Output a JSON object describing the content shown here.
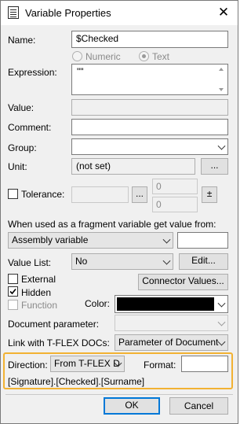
{
  "window": {
    "title": "Variable Properties",
    "close_glyph": "✕"
  },
  "name": {
    "label": "Name:",
    "value": "$Checked"
  },
  "type_radios": {
    "numeric": "Numeric",
    "text": "Text",
    "selected": "Text"
  },
  "expression": {
    "label": "Expression:",
    "value": "\"\""
  },
  "value": {
    "label": "Value:",
    "value": ""
  },
  "comment": {
    "label": "Comment:",
    "value": ""
  },
  "group": {
    "label": "Group:",
    "value": ""
  },
  "unit": {
    "label": "Unit:",
    "value": "(not set)",
    "button": "..."
  },
  "tolerance": {
    "label": "Tolerance:",
    "checked": false,
    "button": "...",
    "upper": "0",
    "lower": "0",
    "pm_button": "±"
  },
  "fragment": {
    "label": "When used as a fragment variable get value from:",
    "source": "Assembly variable",
    "extra": ""
  },
  "value_list": {
    "label": "Value List:",
    "value": "No",
    "edit_button": "Edit..."
  },
  "flags": {
    "external": "External",
    "hidden": "Hidden",
    "function": "Function",
    "external_checked": false,
    "hidden_checked": true,
    "function_checked": false
  },
  "connector_button": "Connector Values...",
  "color": {
    "label": "Color:",
    "value": "#000000"
  },
  "doc_param": {
    "label": "Document parameter:",
    "value": ""
  },
  "link": {
    "label": "Link with T-FLEX DOCs:",
    "value": "Parameter of Document"
  },
  "direction": {
    "label": "Direction:",
    "value": "From T-FLEX D",
    "format_label": "Format:",
    "format_value": ""
  },
  "path": "[Signature].[Checked].[Surname]",
  "buttons": {
    "ok": "OK",
    "cancel": "Cancel"
  }
}
